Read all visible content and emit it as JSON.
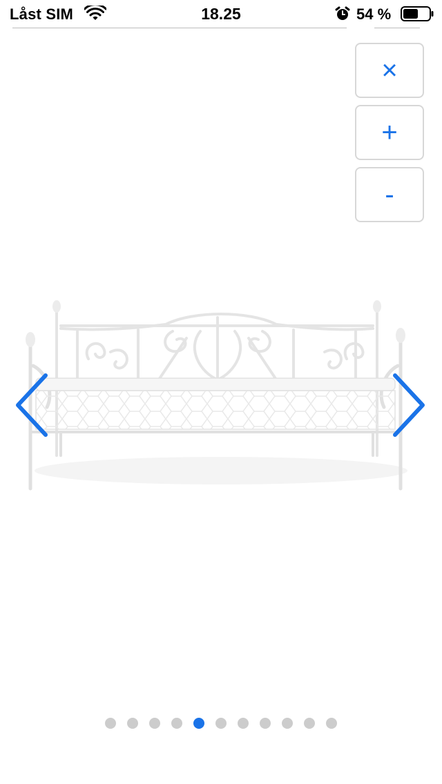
{
  "status_bar": {
    "carrier": "Låst SIM",
    "time": "18.25",
    "battery_percent": "54 %",
    "icons": [
      "wifi-icon",
      "alarm-icon",
      "battery-icon"
    ]
  },
  "controls": {
    "close_symbol": "×",
    "zoom_in_symbol": "+",
    "zoom_out_symbol": "-"
  },
  "gallery": {
    "image_name": "white-metal-daybed-with-mattress",
    "total_images": 11,
    "active_index": 4
  },
  "colors": {
    "accent": "#1a73e8",
    "dot_inactive": "#cccccc",
    "button_border": "#d7d7d7"
  }
}
